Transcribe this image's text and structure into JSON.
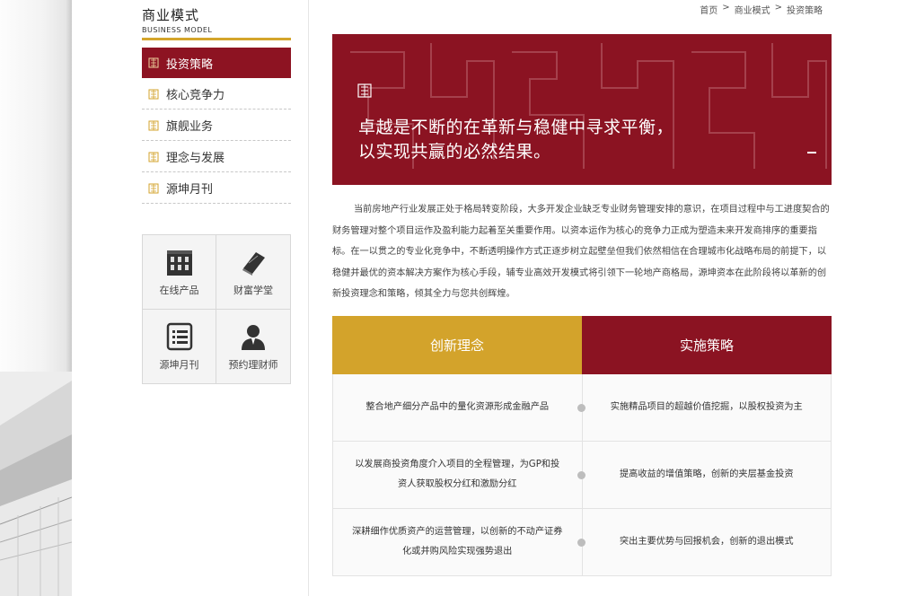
{
  "sidebar": {
    "title": "商业模式",
    "subtitle": "BUSINESS MODEL",
    "items": [
      {
        "label": "投资策略",
        "active": true
      },
      {
        "label": "核心竞争力"
      },
      {
        "label": "旗舰业务"
      },
      {
        "label": "理念与发展"
      },
      {
        "label": "源坤月刊"
      }
    ],
    "quick_links": [
      {
        "label": "在线产品",
        "icon": "building-icon"
      },
      {
        "label": "财富学堂",
        "icon": "book-icon"
      },
      {
        "label": "源坤月刊",
        "icon": "list-icon"
      },
      {
        "label": "预约理财师",
        "icon": "advisor-icon"
      }
    ]
  },
  "breadcrumb": {
    "items": [
      "首页",
      "商业模式",
      "投资策略"
    ],
    "separator": ">"
  },
  "banner": {
    "line1": "卓越是不断的在革新与稳健中寻求平衡，",
    "line2": "以实现共赢的必然结果。",
    "icon": "logo-mark-icon"
  },
  "intro": "当前房地产行业发展正处于格局转变阶段，大多开发企业缺乏专业财务管理安排的意识，在项目过程中与工进度契合的财务管理对整个项目运作及盈利能力起着至关重要作用。以资本运作为核心的竞争力正成为塑造未来开发商排序的重要指标。在一以贯之的专业化竞争中，不断透明操作方式正逐步树立起壁垒但我们依然相信在合理城市化战略布局的前提下，以稳健并最优的资本解决方案作为核心手段，辅专业高效开发模式将引领下一轮地产商格局，源坤资本在此阶段将以革新的创新投资理念和策略，倾其全力与您共创辉煌。",
  "table": {
    "headers": [
      "创新理念",
      "实施策略"
    ],
    "rows": [
      {
        "left": "整合地产细分产品中的量化资源形成金融产品",
        "right": "实施精品项目的超越价值挖掘，以股权投资为主"
      },
      {
        "left": "以发展商投资角度介入项目的全程管理，为GP和投资人获取股权分红和激励分红",
        "right": "提高收益的增值策略，创新的夹层基金投资"
      },
      {
        "left": "深耕细作优质资产的运营管理，以创新的不动产证券化或并购风险实现强势退出",
        "right": "突出主要优势与回报机会，创新的退出模式"
      }
    ]
  },
  "colors": {
    "brand_red": "#8b1322",
    "gold": "#d3a32b"
  }
}
